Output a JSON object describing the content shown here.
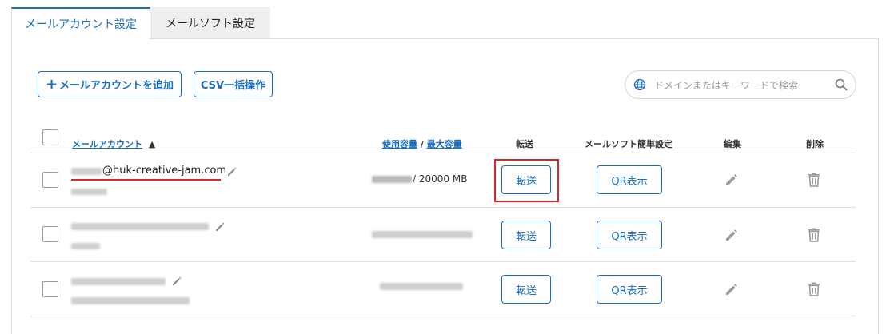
{
  "tabs": [
    {
      "label": "メールアカウント設定",
      "active": true
    },
    {
      "label": "メールソフト設定",
      "active": false
    }
  ],
  "toolbar": {
    "add_label": "メールアカウントを追加",
    "csv_label": "CSV一括操作"
  },
  "search": {
    "placeholder": "ドメインまたはキーワードで検索"
  },
  "table": {
    "headers": {
      "account": "メールアカウント",
      "sort_indicator": "▲",
      "usage": "使用容量",
      "separator": " / ",
      "max": "最大容量",
      "forward": "転送",
      "mailsoft": "メールソフト簡単設定",
      "edit": "編集",
      "delete": "削除"
    },
    "rows": [
      {
        "email_domain": "@huk-creative-jam.com",
        "usage_suffix": " / 20000 MB",
        "forward_label": "転送",
        "qr_label": "QR表示"
      },
      {
        "email_domain": "",
        "usage_suffix": "",
        "forward_label": "転送",
        "qr_label": "QR表示"
      },
      {
        "email_domain": "",
        "usage_suffix": "",
        "forward_label": "転送",
        "qr_label": "QR表示"
      }
    ]
  },
  "colors": {
    "accent": "#1a6ec0",
    "highlight": "#e02424"
  }
}
